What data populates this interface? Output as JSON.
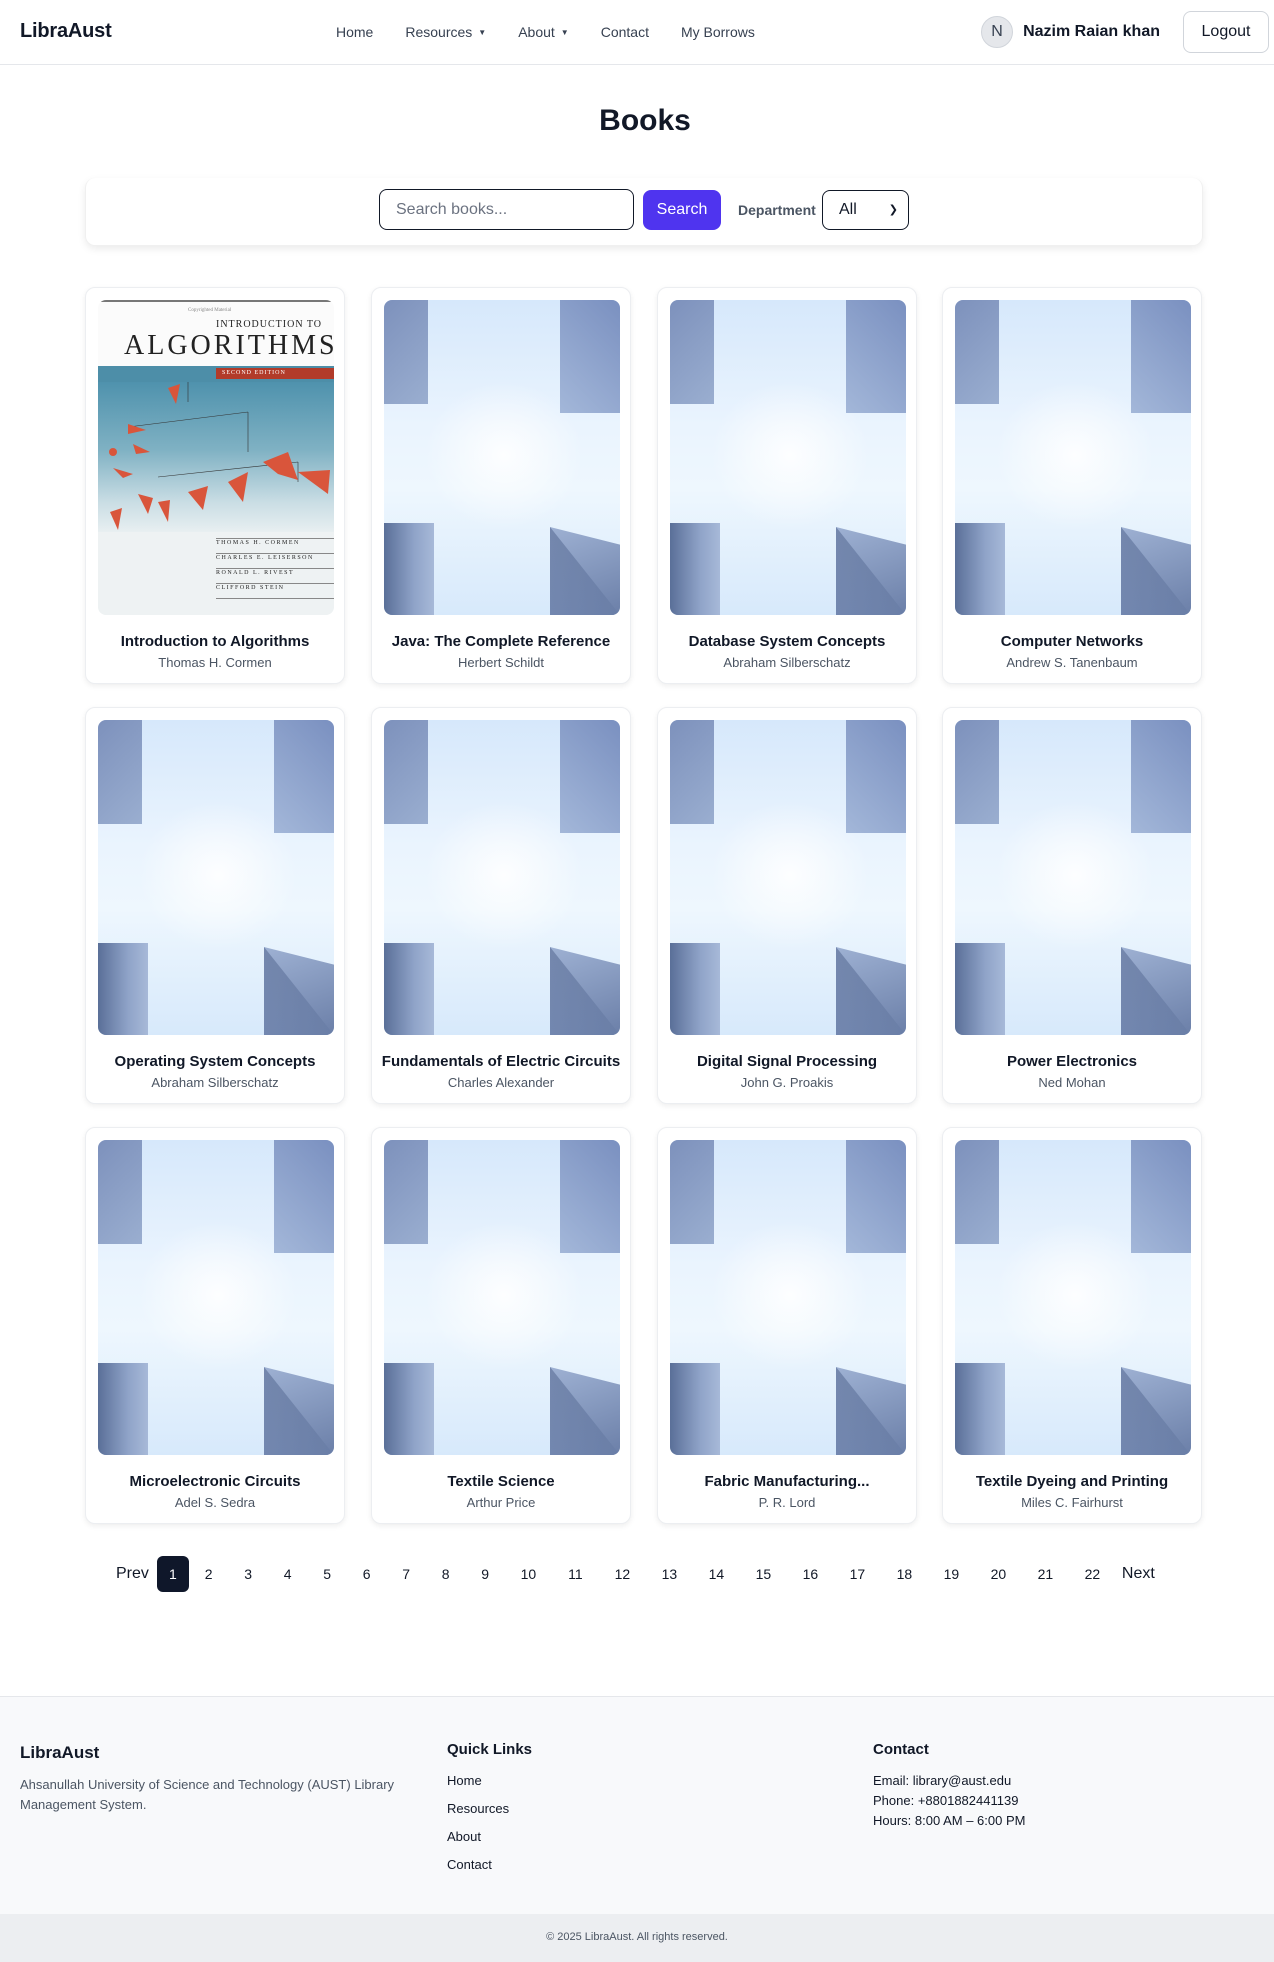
{
  "navbar": {
    "brand": "LibraAust",
    "links": [
      {
        "label": "Home",
        "has_caret": false
      },
      {
        "label": "Resources",
        "has_caret": true
      },
      {
        "label": "About",
        "has_caret": true
      },
      {
        "label": "Contact",
        "has_caret": false
      },
      {
        "label": "My Borrows",
        "has_caret": false
      }
    ],
    "caret_icon": "▼",
    "user": {
      "initial": "N",
      "name": "Nazim Raian khan"
    },
    "logout_label": "Logout"
  },
  "page_title": "Books",
  "search": {
    "placeholder": "Search books...",
    "value": "",
    "button_label": "Search",
    "department_label": "Department",
    "department_selected": "All"
  },
  "books": [
    {
      "title": "Introduction to Algorithms",
      "author": "Thomas H. Cormen",
      "cover": "algorithms"
    },
    {
      "title": "Java: The Complete Reference",
      "author": "Herbert Schildt",
      "cover": "placeholder"
    },
    {
      "title": "Database System Concepts",
      "author": "Abraham Silberschatz",
      "cover": "placeholder"
    },
    {
      "title": "Computer Networks",
      "author": "Andrew S. Tanenbaum",
      "cover": "placeholder"
    },
    {
      "title": "Operating System Concepts",
      "author": "Abraham Silberschatz",
      "cover": "placeholder"
    },
    {
      "title": "Fundamentals of Electric Circuits",
      "author": "Charles Alexander",
      "cover": "placeholder"
    },
    {
      "title": "Digital Signal Processing",
      "author": "John G. Proakis",
      "cover": "placeholder"
    },
    {
      "title": "Power Electronics",
      "author": "Ned Mohan",
      "cover": "placeholder"
    },
    {
      "title": "Microelectronic Circuits",
      "author": "Adel S. Sedra",
      "cover": "placeholder"
    },
    {
      "title": "Textile Science",
      "author": "Arthur Price",
      "cover": "placeholder"
    },
    {
      "title": "Fabric Manufacturing...",
      "author": "P. R. Lord",
      "cover": "placeholder"
    },
    {
      "title": "Textile Dyeing and Printing",
      "author": "Miles C. Fairhurst",
      "cover": "placeholder"
    }
  ],
  "algorithms_cover": {
    "copyright_note": "Copyrighted Material",
    "intro": "INTRODUCTION TO",
    "word": "ALGORITHMS",
    "edition": "SECOND EDITION",
    "authors": [
      "THOMAS H. CORMEN",
      "CHARLES E. LEISERSON",
      "RONALD L. RIVEST",
      "CLIFFORD STEIN"
    ]
  },
  "pagination": {
    "prev_label": "Prev",
    "next_label": "Next",
    "current_page": 1,
    "pages": [
      "1",
      "2",
      "3",
      "4",
      "5",
      "6",
      "7",
      "8",
      "9",
      "10",
      "11",
      "12",
      "13",
      "14",
      "15",
      "16",
      "17",
      "18",
      "19",
      "20",
      "21",
      "22"
    ]
  },
  "footer": {
    "brand": "LibraAust",
    "description": "Ahsanullah University of Science and Technology (AUST) Library Management System.",
    "quick_links_heading": "Quick Links",
    "quick_links": [
      "Home",
      "Resources",
      "About",
      "Contact"
    ],
    "contact_heading": "Contact",
    "email": "Email: library@aust.edu",
    "phone": "Phone: +8801882441139",
    "hours": "Hours: 8:00 AM – 6:00 PM",
    "copyright": "© 2025 LibraAust. All rights reserved."
  },
  "colors": {
    "accent": "#4f34ef",
    "active_page": "#0f172a",
    "footer_bg": "#f8f9fb"
  }
}
